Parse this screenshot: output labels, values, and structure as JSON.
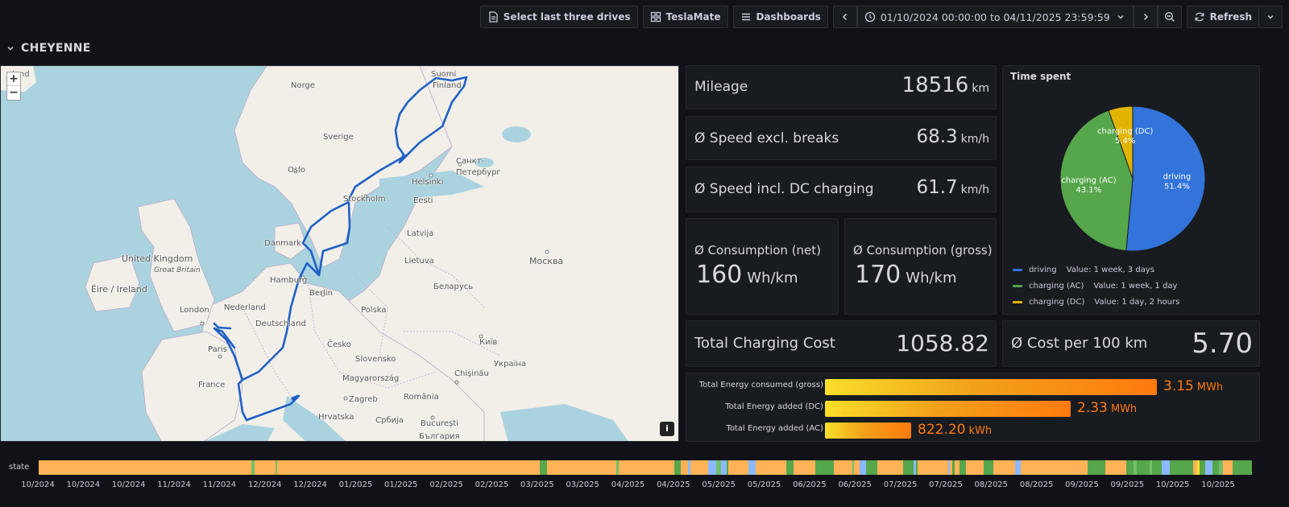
{
  "toolbar": {
    "select_drives": "Select last three drives",
    "teslamate": "TeslaMate",
    "dashboards": "Dashboards",
    "time_range": "01/10/2024 00:00:00 to 04/11/2025 23:59:59",
    "refresh": "Refresh"
  },
  "row": {
    "title": "CHEYENNE"
  },
  "map": {
    "zoom_in": "+",
    "zoom_out": "−",
    "info": "i",
    "labels": [
      {
        "text": "Suomi",
        "k": "suomi"
      },
      {
        "text": "Finland",
        "k": "finland"
      },
      {
        "text": "Norge",
        "k": "norge"
      },
      {
        "text": "Sverige",
        "k": "sverige"
      },
      {
        "text": "Oslo",
        "k": "oslo"
      },
      {
        "text": "Helsinki",
        "k": "helsinki"
      },
      {
        "text": "Санкт-",
        "k": "spb1"
      },
      {
        "text": "Петербург",
        "k": "spb2"
      },
      {
        "text": "Stockholm",
        "k": "stockholm"
      },
      {
        "text": "Eesti",
        "k": "eesti"
      },
      {
        "text": "Latvija",
        "k": "latvija"
      },
      {
        "text": "Danmark",
        "k": "danmark"
      },
      {
        "text": "Lietuva",
        "k": "lietuva"
      },
      {
        "text": "United Kingdom",
        "k": "uk"
      },
      {
        "text": "Great Britain",
        "k": "gb"
      },
      {
        "text": "Éire / Ireland",
        "k": "ireland"
      },
      {
        "text": "Hamburg",
        "k": "hamburg"
      },
      {
        "text": "Berlin",
        "k": "berlin"
      },
      {
        "text": "Москва",
        "k": "moskva"
      },
      {
        "text": "Беларусь",
        "k": "belarus"
      },
      {
        "text": "London",
        "k": "london"
      },
      {
        "text": "Nederland",
        "k": "nederland"
      },
      {
        "text": "Polska",
        "k": "polska"
      },
      {
        "text": "Deutschland",
        "k": "deutschland"
      },
      {
        "text": "Paris",
        "k": "paris"
      },
      {
        "text": "Česko",
        "k": "cesko"
      },
      {
        "text": "Київ",
        "k": "kyiv"
      },
      {
        "text": "Slovensko",
        "k": "slovensko"
      },
      {
        "text": "Україна",
        "k": "ukraina"
      },
      {
        "text": "France",
        "k": "france"
      },
      {
        "text": "Magyarország",
        "k": "magyar"
      },
      {
        "text": "Chişinău",
        "k": "chisinau"
      },
      {
        "text": "Zagreb",
        "k": "zagreb"
      },
      {
        "text": "România",
        "k": "romania"
      },
      {
        "text": "Hrvatska",
        "k": "hrvatska"
      },
      {
        "text": "Србија",
        "k": "srbija"
      },
      {
        "text": "București",
        "k": "bucuresti"
      },
      {
        "text": "България",
        "k": "bulgaria"
      },
      {
        "text": "land",
        "k": "iceland"
      }
    ]
  },
  "stats": {
    "mileage": {
      "label": "Mileage",
      "value": "18516",
      "unit": "km"
    },
    "speed_excl": {
      "label": "Ø Speed excl. breaks",
      "value": "68.3",
      "unit": "km/h"
    },
    "speed_incl": {
      "label": "Ø Speed incl. DC charging",
      "value": "61.7",
      "unit": "km/h"
    },
    "cons_net": {
      "label": "Ø Consumption (net)",
      "value": "160",
      "unit": "Wh/km"
    },
    "cons_gross": {
      "label": "Ø Consumption (gross)",
      "value": "170",
      "unit": "Wh/km"
    },
    "charging_cost": {
      "label": "Total Charging Cost",
      "value": "1058.82"
    },
    "cost_per_100": {
      "label": "Ø Cost per 100 km",
      "value": "5.70"
    }
  },
  "pie": {
    "title": "Time spent",
    "slices": [
      {
        "name": "driving",
        "pct": 51.4,
        "pct_label": "51.4%",
        "color": "#3274d9",
        "value_label": "Value: 1 week, 3 days"
      },
      {
        "name": "charging (AC)",
        "pct": 43.1,
        "pct_label": "43.1%",
        "color": "#56a64b",
        "value_label": "Value: 1 week, 1 day"
      },
      {
        "name": "charging (DC)",
        "pct": 5.4,
        "pct_label": "5.4%",
        "color": "#e0b400",
        "value_label": "Value: 1 day, 2 hours"
      }
    ]
  },
  "gauges": [
    {
      "label": "Total Energy consumed (gross)",
      "value": "3.15",
      "unit": "MWh",
      "fraction": 1.0
    },
    {
      "label": "Total Energy added (DC)",
      "value": "2.33",
      "unit": "MWh",
      "fraction": 0.74
    },
    {
      "label": "Total Energy added (AC)",
      "value": "822.20",
      "unit": "kWh",
      "fraction": 0.26
    }
  ],
  "state": {
    "label": "state",
    "ticks": [
      "10/2024",
      "10/2024",
      "10/2024",
      "11/2024",
      "11/2024",
      "12/2024",
      "12/2024",
      "01/2025",
      "01/2025",
      "02/2025",
      "02/2025",
      "03/2025",
      "03/2025",
      "04/2025",
      "04/2025",
      "05/2025",
      "05/2025",
      "06/2025",
      "06/2025",
      "07/2025",
      "07/2025",
      "08/2025",
      "08/2025",
      "09/2025",
      "09/2025",
      "10/2025",
      "10/2025"
    ],
    "colors": {
      "asleep": "#ffb357",
      "driving": "#56a64b",
      "charging": "#8ab8ff",
      "online": "#73bf69",
      "updating": "#f2495c",
      "offline": "#fade2a"
    }
  }
}
